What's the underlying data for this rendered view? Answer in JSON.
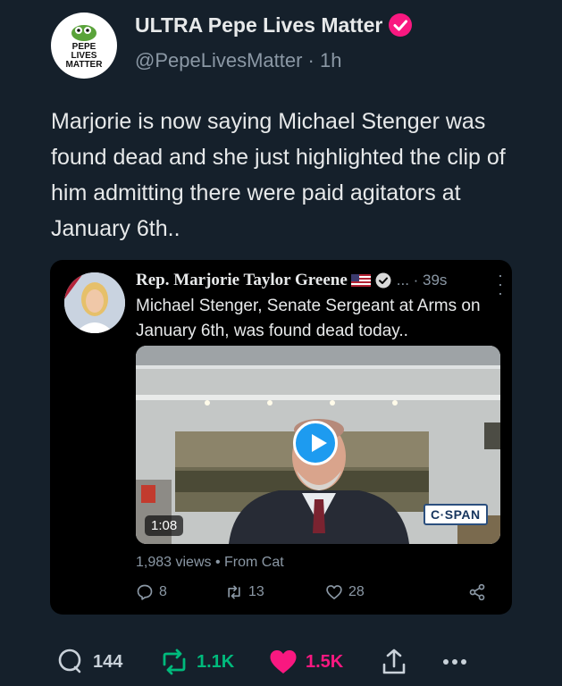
{
  "author": {
    "display_name": "ULTRA Pepe Lives Matter",
    "handle": "@PepeLivesMatter",
    "separator": "·",
    "time": "1h",
    "avatar_text": [
      "PEPE",
      "LIVES",
      "MATTER"
    ],
    "verified_icon": "verified-badge-icon"
  },
  "tweet": {
    "text": "Marjorie is now saying Michael Stenger was found dead and she just highlighted the clip of him admitting there were paid agitators at January 6th.."
  },
  "quote": {
    "display_name": "Rep. Marjorie Taylor Greene",
    "meta": "... · 39s",
    "text": "Michael Stenger, Senate Sergeant at Arms on January 6th, was found dead today..",
    "video": {
      "duration": "1:08",
      "watermark": "C·SPAN"
    },
    "views": "1,983 views • From Cat",
    "actions": {
      "replies": "8",
      "retweets": "13",
      "likes": "28"
    }
  },
  "actions": {
    "replies": "144",
    "retweets": "1.1K",
    "likes": "1.5K"
  },
  "colors": {
    "background": "#15202b",
    "text": "#e7e9ea",
    "muted": "#8b98a5",
    "retweet": "#00ba7c",
    "like": "#f91880",
    "link": "#1d9bf0",
    "verified_badge": "#f91880"
  }
}
